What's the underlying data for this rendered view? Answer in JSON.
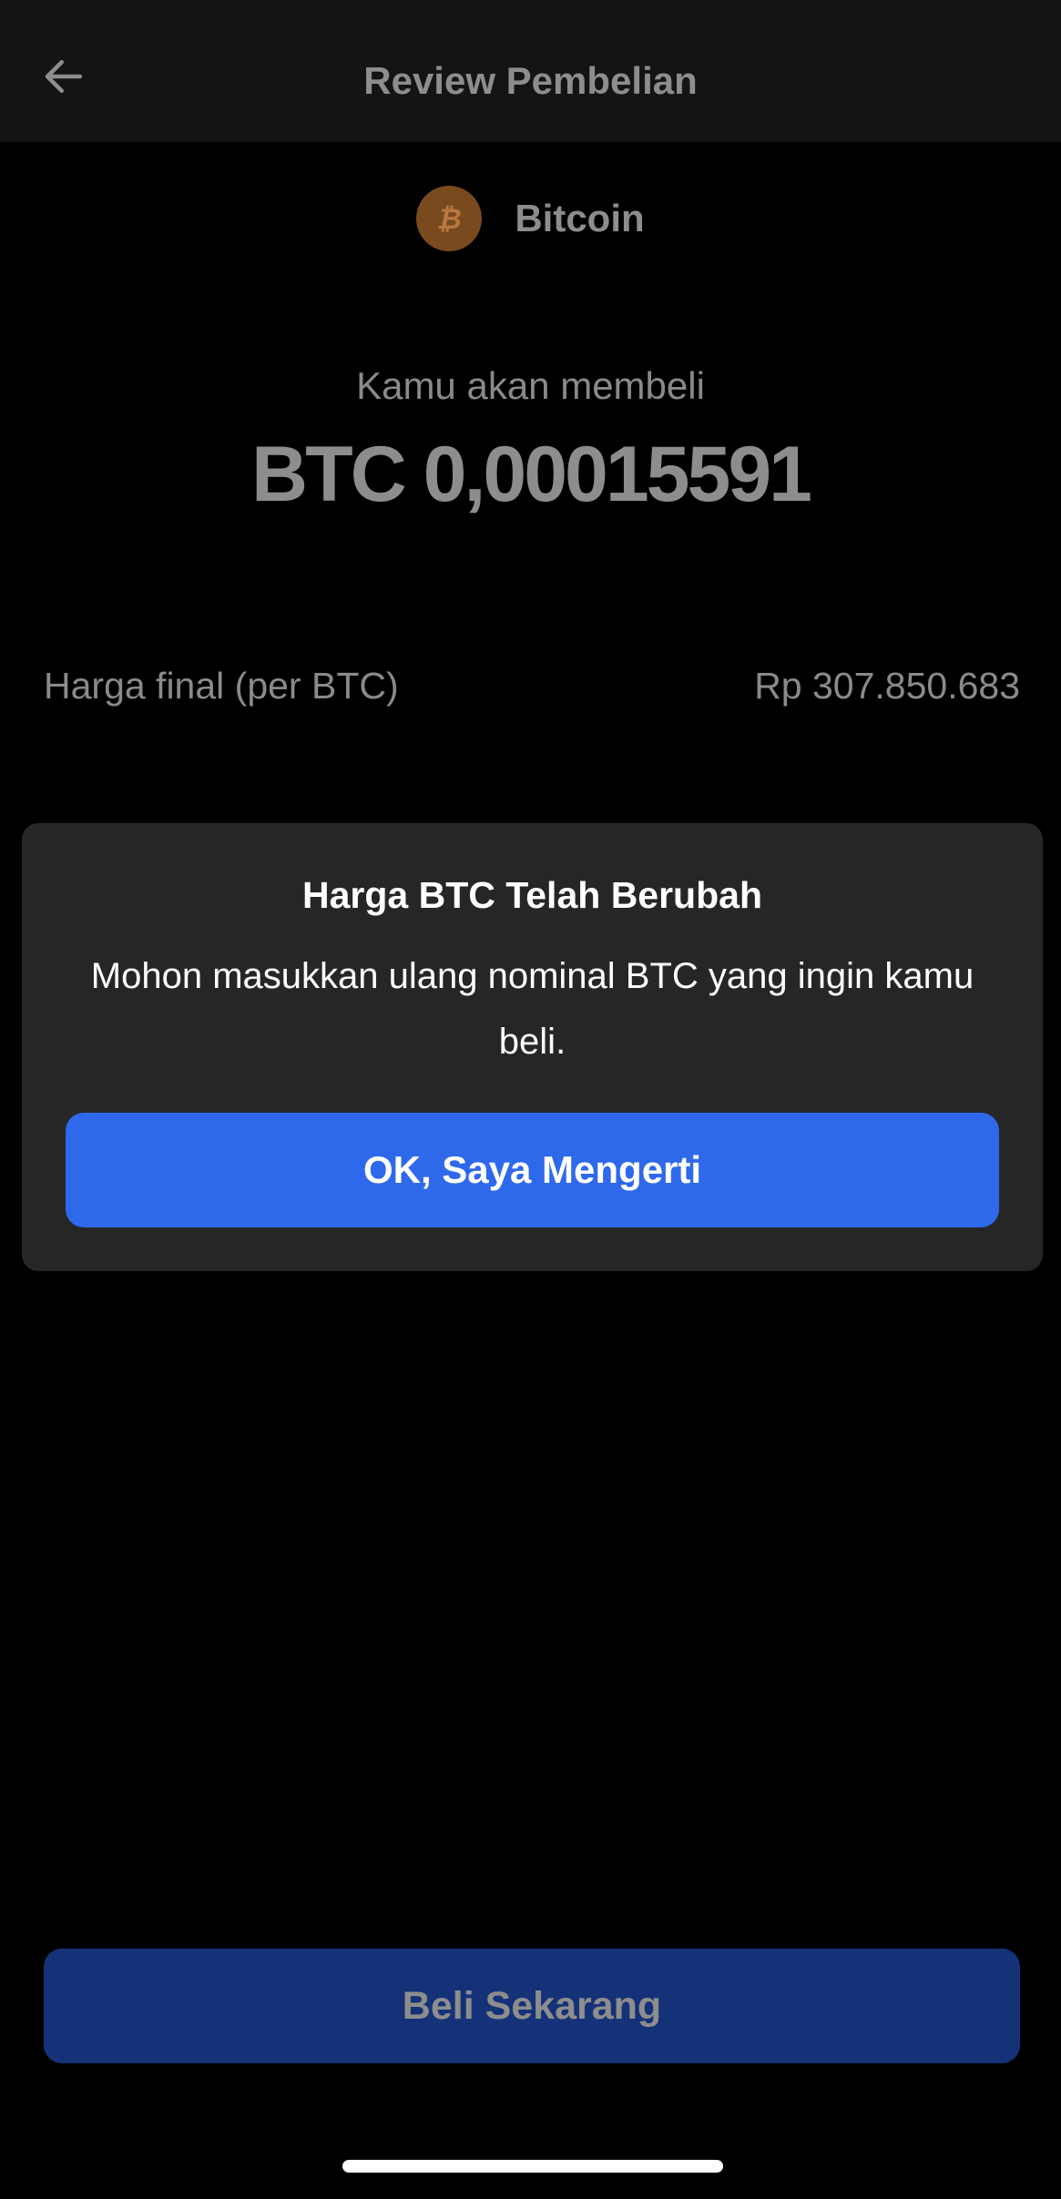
{
  "header": {
    "title": "Review Pembelian",
    "back_icon": "arrow-left-icon"
  },
  "asset": {
    "name": "Bitcoin",
    "icon": "bitcoin-icon",
    "icon_color": "#7a4a1f"
  },
  "summary": {
    "buy_label": "Kamu akan membeli",
    "amount": "BTC 0,00015591"
  },
  "price": {
    "label": "Harga final (per BTC)",
    "value": "Rp 307.850.683"
  },
  "dialog": {
    "title": "Harga BTC Telah Berubah",
    "message": "Mohon masukkan ulang nominal BTC yang ingin kamu beli.",
    "confirm_label": "OK, Saya Mengerti",
    "confirm_color": "#2f69eb"
  },
  "footer": {
    "buy_label": "Beli Sekarang",
    "buy_color": "#153278"
  }
}
